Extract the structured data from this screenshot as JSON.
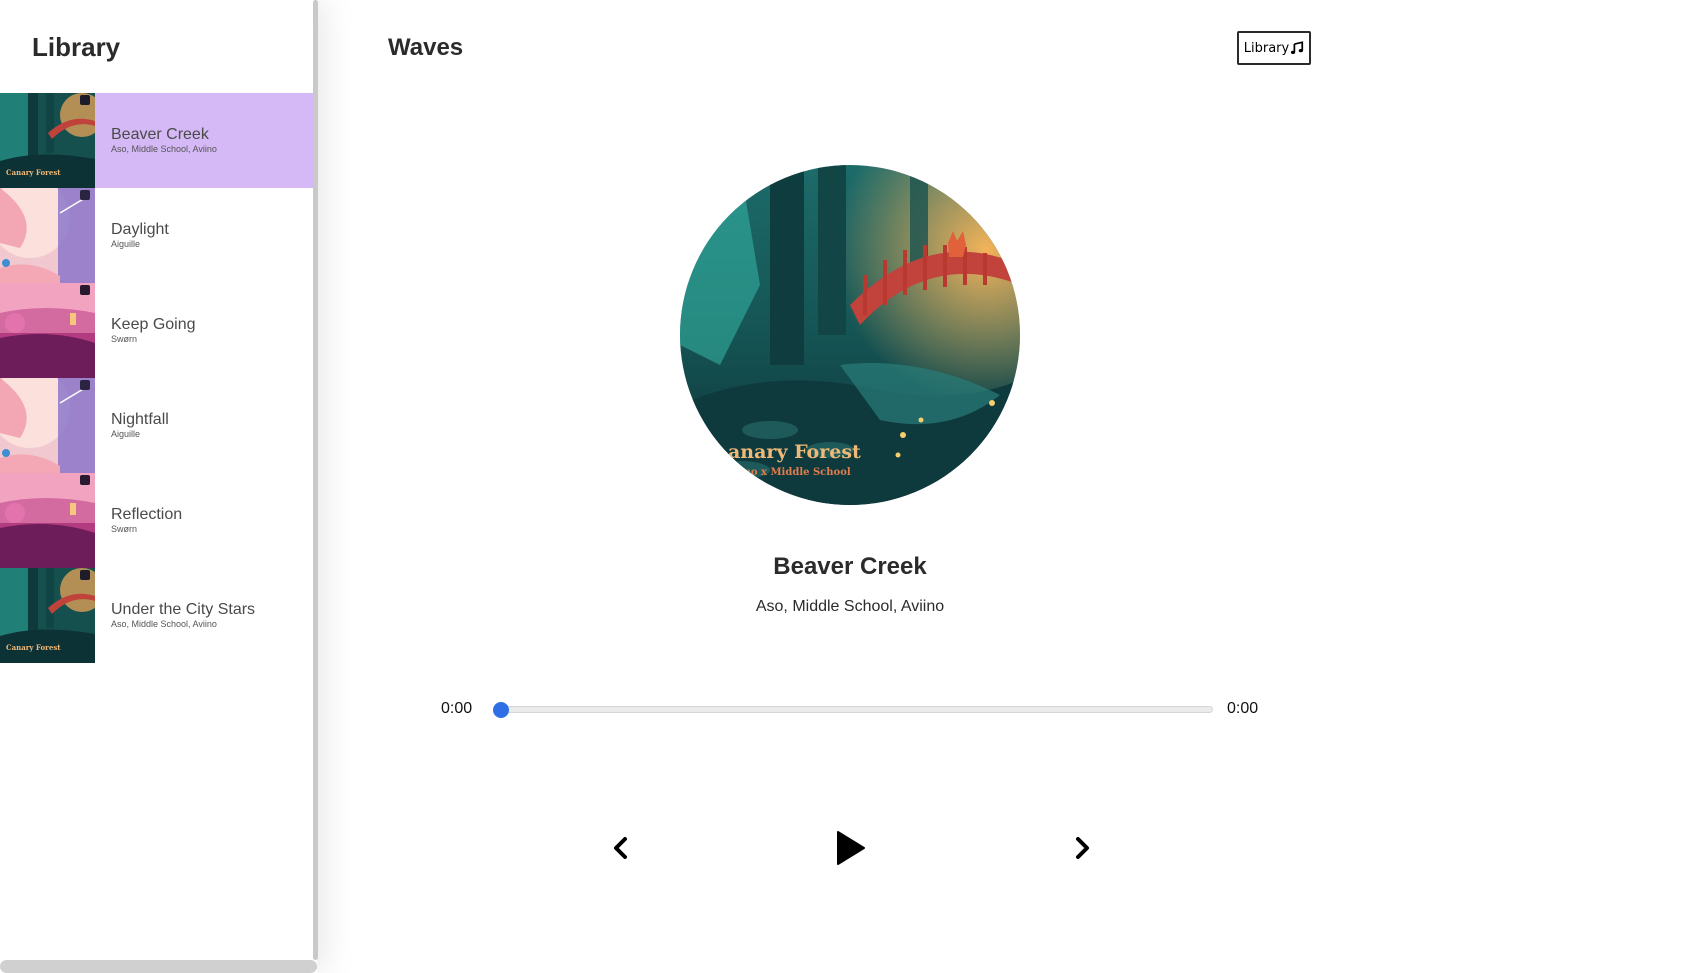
{
  "library": {
    "title": "Library",
    "songs": [
      {
        "name": "Beaver Creek",
        "artist": "Aso, Middle School, Aviino",
        "active": true,
        "art": "forest"
      },
      {
        "name": "Daylight",
        "artist": "Aiguille",
        "active": false,
        "art": "pink-sky"
      },
      {
        "name": "Keep Going",
        "artist": "Swørn",
        "active": false,
        "art": "magenta-dusk"
      },
      {
        "name": "Nightfall",
        "artist": "Aiguille",
        "active": false,
        "art": "pink-sky"
      },
      {
        "name": "Reflection",
        "artist": "Swørn",
        "active": false,
        "art": "magenta-dusk"
      },
      {
        "name": "Under the City Stars",
        "artist": "Aso, Middle School, Aviino",
        "active": false,
        "art": "forest"
      }
    ]
  },
  "header": {
    "brand": "Waves",
    "library_button_label": "Library",
    "library_button_icon": "music-note-icon"
  },
  "player": {
    "cover_art": "forest",
    "cover_text": "anary Forest",
    "cover_subtext": "iino x Middle School",
    "title": "Beaver Creek",
    "artist": "Aso, Middle School, Aviino",
    "current_time": "0:00",
    "duration": "0:00",
    "progress": 0,
    "controls": {
      "prev_icon": "chevron-left-icon",
      "play_icon": "play-icon",
      "next_icon": "chevron-right-icon"
    }
  },
  "colors": {
    "active_song_bg": "#d5b8f6",
    "seek_thumb": "#2f6fe6",
    "text": "#2b2b2b"
  }
}
